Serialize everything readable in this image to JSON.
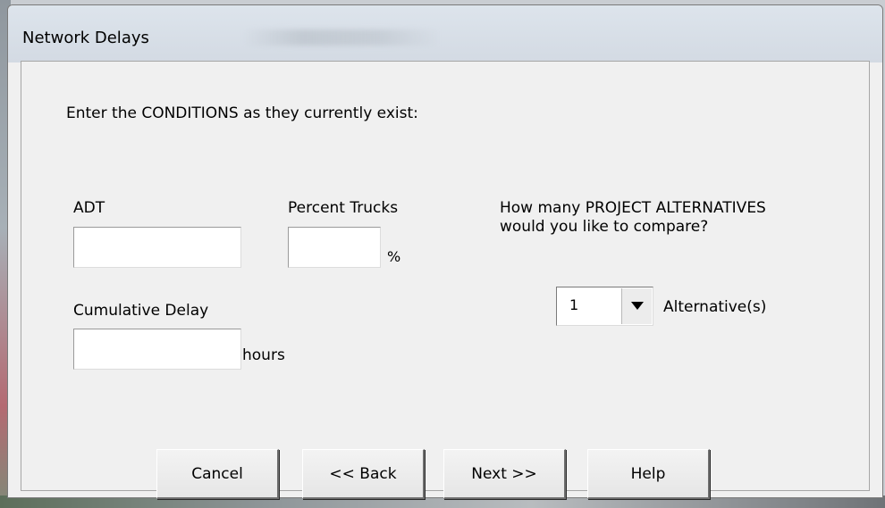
{
  "dialog": {
    "title": "Network Delays"
  },
  "instructions": "Enter the CONDITIONS as they currently exist:",
  "fields": {
    "adt": {
      "label": "ADT",
      "value": ""
    },
    "percent_trucks": {
      "label": "Percent Trucks",
      "value": "",
      "unit": "%"
    },
    "cumulative_delay": {
      "label": "Cumulative Delay",
      "value": "",
      "unit": "hours"
    }
  },
  "alternatives": {
    "question_line1": "How many PROJECT ALTERNATIVES",
    "question_line2": "would you like to compare?",
    "selected": "1",
    "suffix": "Alternative(s)"
  },
  "buttons": {
    "cancel": "Cancel",
    "back": "<< Back",
    "next": "Next >>",
    "help": "Help"
  }
}
